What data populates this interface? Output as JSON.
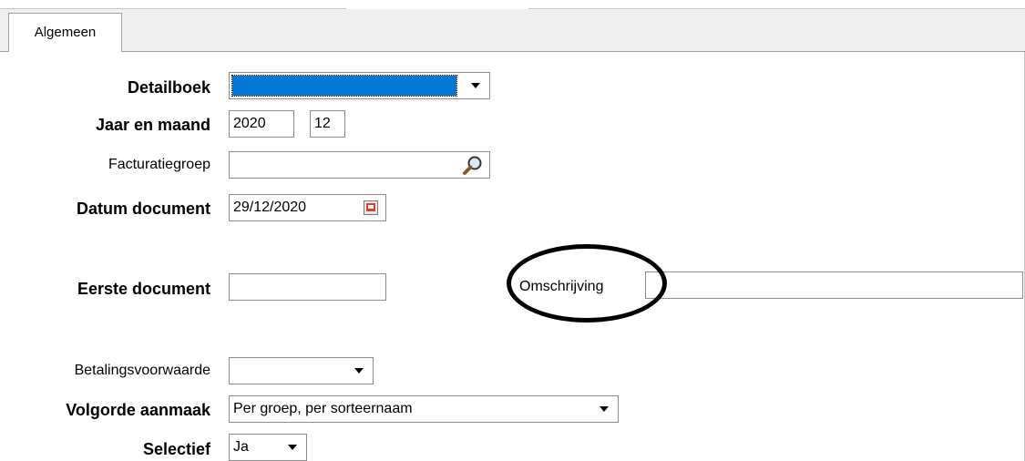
{
  "tabs": [
    {
      "label": "Algemeen"
    }
  ],
  "form": {
    "detailboek": {
      "label": "Detailboek",
      "value": ""
    },
    "jaar_en_maand": {
      "label": "Jaar en maand",
      "year": "2020",
      "month": "12"
    },
    "facturatiegroep": {
      "label": "Facturatiegroep",
      "value": ""
    },
    "datum_document": {
      "label": "Datum document",
      "value": "29/12/2020"
    },
    "eerste_document": {
      "label": "Eerste document",
      "value": ""
    },
    "omschrijving": {
      "label": "Omschrijving",
      "value": ""
    },
    "betalingsvoorwaarde": {
      "label": "Betalingsvoorwaarde",
      "value": ""
    },
    "volgorde_aanmaak": {
      "label": "Volgorde aanmaak",
      "value": "Per groep, per sorteernaam"
    },
    "selectief": {
      "label": "Selectief",
      "value": "Ja"
    }
  },
  "icons": {
    "dropdown": "chevron-down-icon",
    "search": "search-icon",
    "calendar": "calendar-icon"
  },
  "colors": {
    "selection": "#0078d7",
    "annotation": "#000000"
  }
}
